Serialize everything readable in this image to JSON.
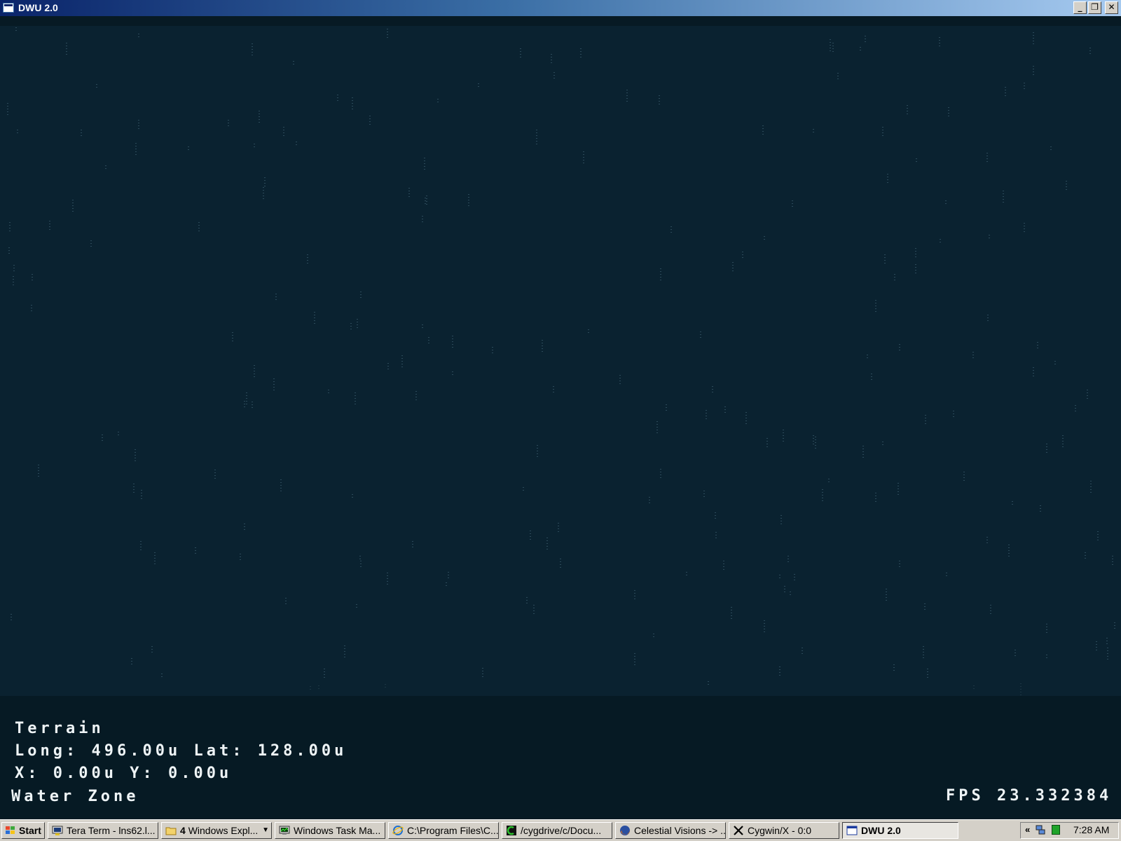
{
  "window": {
    "title": "DWU 2.0",
    "controls": {
      "minimize": "_",
      "restore": "❐",
      "close": "✕"
    }
  },
  "game": {
    "hud": {
      "terrain": "Terrain",
      "long_label": "Long:",
      "long_value": "496.00u",
      "lat_label": "Lat:",
      "lat_value": "128.00u",
      "x_label": "X:",
      "x_value": "0.00u",
      "y_label": "Y:",
      "y_value": "0.00u",
      "zone": "Water Zone",
      "fps_label": "FPS",
      "fps_value": "23.332384"
    },
    "colors": {
      "water": "#0a2230",
      "hud_panel": "#061a24",
      "hud_text": "#eef4f6"
    }
  },
  "taskbar": {
    "start": {
      "label": "Start",
      "icon": "windows-flag-icon"
    },
    "items": [
      {
        "label": "Tera Term - lns62.l...",
        "icon": "tera-term-icon"
      },
      {
        "count": "4",
        "label": "Windows Expl...",
        "icon": "folder-icon"
      },
      {
        "label": "Windows Task Ma...",
        "icon": "task-manager-icon"
      },
      {
        "label": "C:\\Program Files\\C...",
        "icon": "internet-explorer-icon"
      },
      {
        "label": "/cygdrive/c/Docu...",
        "icon": "cygwin-icon"
      },
      {
        "label": "Celestial Visions -> ...",
        "icon": "firefox-icon"
      },
      {
        "label": "Cygwin/X - 0:0",
        "icon": "x-server-icon"
      },
      {
        "label": "DWU 2.0",
        "icon": "window-icon",
        "active": true
      }
    ],
    "tray": {
      "chevron": "«",
      "clock": "7:28 AM"
    }
  }
}
